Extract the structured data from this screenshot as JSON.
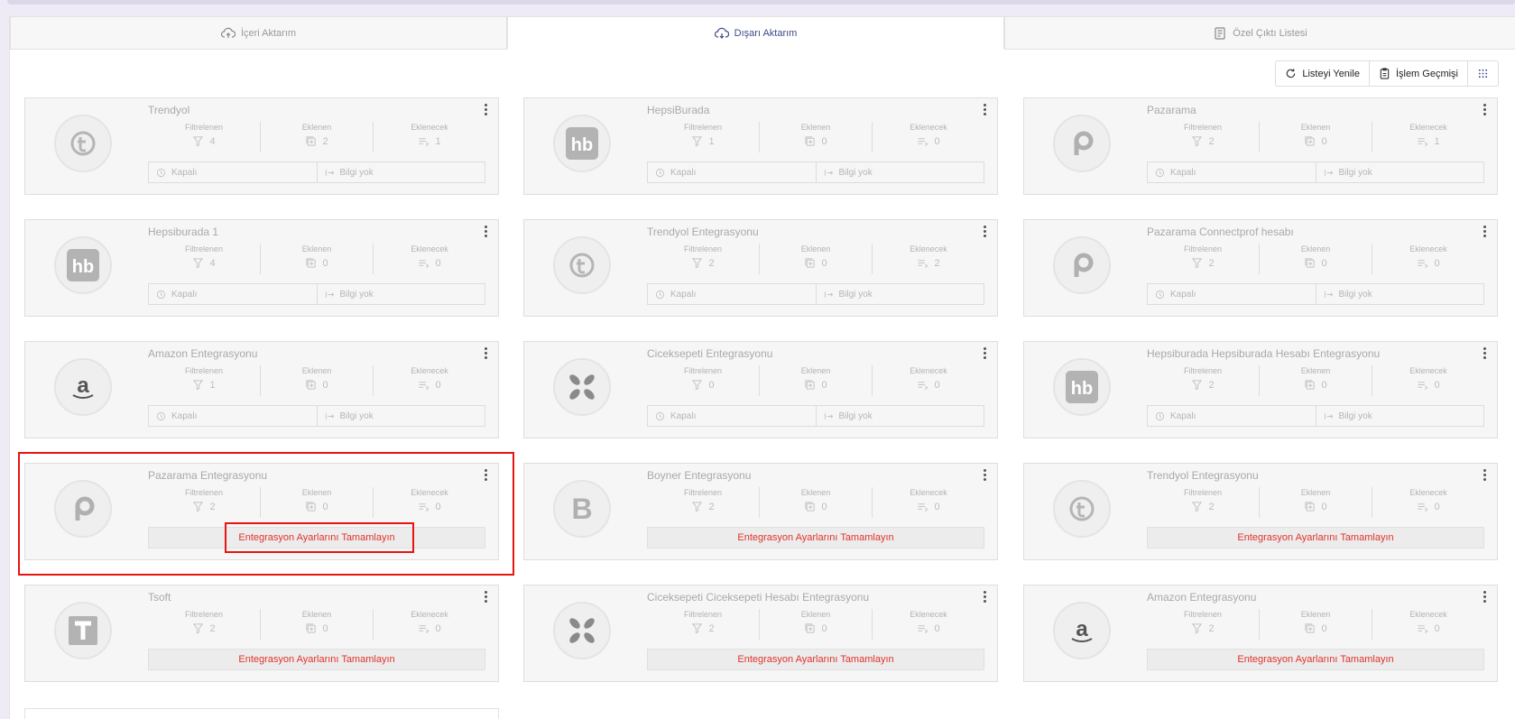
{
  "tabs": [
    {
      "label": "İçeri Aktarım",
      "icon": "cloud-upload-icon",
      "active": false
    },
    {
      "label": "Dışarı Aktarım",
      "icon": "cloud-download-icon",
      "active": true
    },
    {
      "label": "Özel Çıktı Listesi",
      "icon": "list-document-icon",
      "active": false
    }
  ],
  "toolbar": {
    "refresh_label": "Listeyi Yenile",
    "history_label": "İşlem Geçmişi"
  },
  "stat_labels": {
    "filtered": "Filtrelenen",
    "added": "Eklenen",
    "to_add": "Eklenecek"
  },
  "status_labels": {
    "state": "Kapalı",
    "info": "Bilgi yok"
  },
  "warning_text": "Entegrasyon Ayarlarını Tamamlayın",
  "colors": {
    "accent": "#3d4a8a",
    "warning": "#e0332b",
    "highlight": "#e81313"
  },
  "cards": [
    {
      "title": "Trendyol",
      "logo": "trendyol",
      "filtered": "4",
      "added": "2",
      "to_add": "1",
      "mode": "status"
    },
    {
      "title": "HepsiBurada",
      "logo": "hb",
      "filtered": "1",
      "added": "0",
      "to_add": "0",
      "mode": "status"
    },
    {
      "title": "Pazarama",
      "logo": "pazarama",
      "filtered": "2",
      "added": "0",
      "to_add": "1",
      "mode": "status"
    },
    {
      "title": "Hepsiburada 1",
      "logo": "hb",
      "filtered": "4",
      "added": "0",
      "to_add": "0",
      "mode": "status"
    },
    {
      "title": "Trendyol Entegrasyonu",
      "logo": "trendyol",
      "filtered": "2",
      "added": "0",
      "to_add": "2",
      "mode": "status"
    },
    {
      "title": "Pazarama Connectprof hesabı",
      "logo": "pazarama",
      "filtered": "2",
      "added": "0",
      "to_add": "0",
      "mode": "status"
    },
    {
      "title": "Amazon Entegrasyonu",
      "logo": "amazon",
      "filtered": "1",
      "added": "0",
      "to_add": "0",
      "mode": "status"
    },
    {
      "title": "Ciceksepeti Entegrasyonu",
      "logo": "ciceksepeti",
      "filtered": "0",
      "added": "0",
      "to_add": "0",
      "mode": "status"
    },
    {
      "title": "Hepsiburada Hepsiburada Hesabı Entegrasyonu",
      "logo": "hb",
      "filtered": "2",
      "added": "0",
      "to_add": "0",
      "mode": "status"
    },
    {
      "title": "Pazarama Entegrasyonu",
      "logo": "pazarama",
      "filtered": "2",
      "added": "0",
      "to_add": "0",
      "mode": "warning"
    },
    {
      "title": "Boyner Entegrasyonu",
      "logo": "boyner",
      "filtered": "2",
      "added": "0",
      "to_add": "0",
      "mode": "warning"
    },
    {
      "title": "Trendyol Entegrasyonu",
      "logo": "trendyol",
      "filtered": "2",
      "added": "0",
      "to_add": "0",
      "mode": "warning"
    },
    {
      "title": "Tsoft",
      "logo": "tsoft",
      "filtered": "2",
      "added": "0",
      "to_add": "0",
      "mode": "warning"
    },
    {
      "title": "Ciceksepeti Ciceksepeti Hesabı Entegrasyonu",
      "logo": "ciceksepeti",
      "filtered": "2",
      "added": "0",
      "to_add": "0",
      "mode": "warning"
    },
    {
      "title": "Amazon Entegrasyonu",
      "logo": "amazon",
      "filtered": "2",
      "added": "0",
      "to_add": "0",
      "mode": "warning"
    }
  ]
}
